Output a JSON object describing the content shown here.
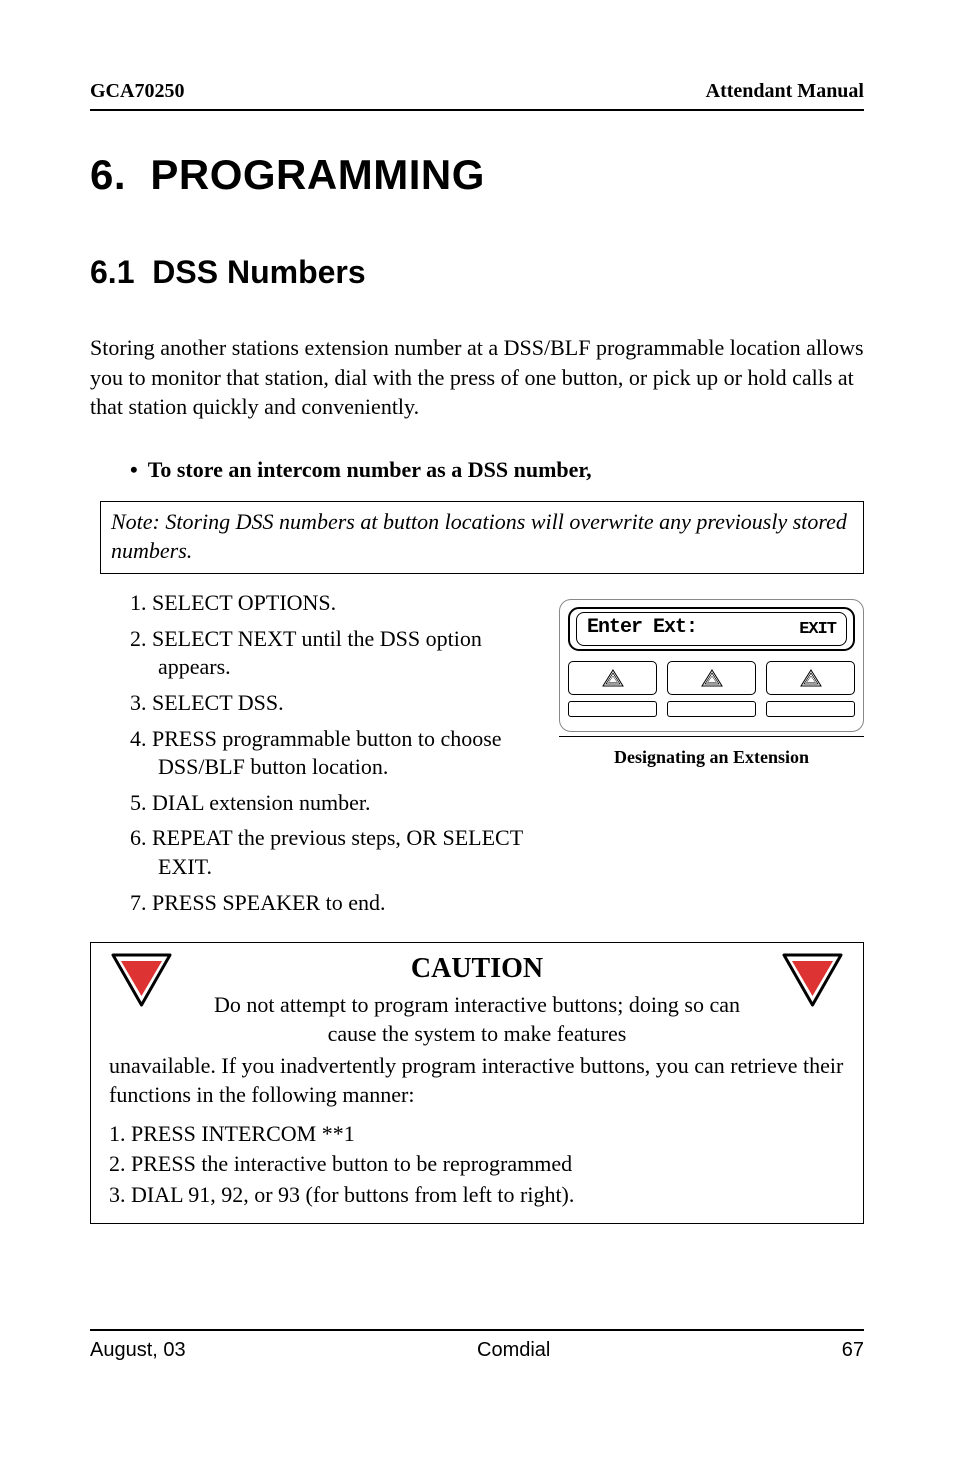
{
  "header": {
    "left": "GCA70250",
    "right": "Attendant Manual"
  },
  "chapter": {
    "number": "6.",
    "title": "PROGRAMMING"
  },
  "section": {
    "number": "6.1",
    "title": "DSS Numbers"
  },
  "intro": "Storing another stations extension number at a DSS/BLF programmable location allows you to monitor that station, dial with the press of one button, or pick up or hold calls at that station quickly and conveniently.",
  "bullet": {
    "marker": "•",
    "text": "To store an intercom number as a DSS number,"
  },
  "note": "Note:  Storing DSS numbers at button locations will overwrite any previously stored numbers.",
  "steps": [
    "1.  SELECT  OPTIONS.",
    "2.  SELECT  NEXT until the  DSS option appears.",
    "3.  SELECT  DSS.",
    "4.  PRESS programmable button to choose DSS/BLF button location.",
    "5.  DIAL extension number.",
    "6.  REPEAT the previous steps, OR SELECT  EXIT.",
    "7.  PRESS SPEAKER to end."
  ],
  "device": {
    "lcd_main": "Enter Ext:",
    "lcd_exit": "EXIT",
    "caption": "Designating an Extension"
  },
  "caution": {
    "title": "CAUTION",
    "mid": "Do not attempt to program interactive buttons; doing so can cause the system to make features",
    "rest": "unavailable.  If you inadvertently program interactive buttons, you can retrieve their functions in the following manner:",
    "steps": [
      "1.  PRESS INTERCOM  **1",
      "2.  PRESS the interactive button to be reprogrammed",
      "3.  DIAL  91,  92, or  93  (for buttons from left to right)."
    ]
  },
  "footer": {
    "left": "August, 03",
    "center": "Comdial",
    "right": "67"
  }
}
